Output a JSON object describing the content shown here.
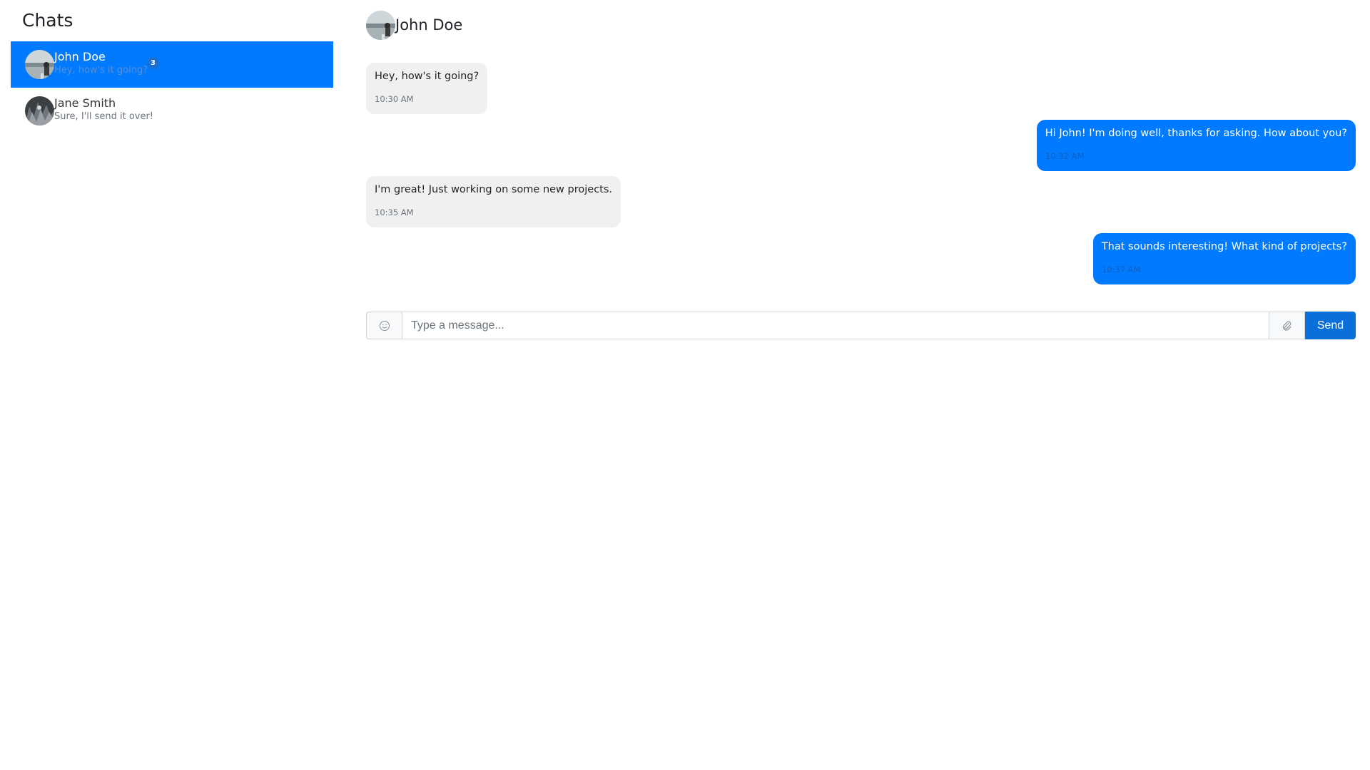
{
  "sidebar": {
    "title": "Chats",
    "chats": [
      {
        "name": "John Doe",
        "preview": "Hey, how's it going?",
        "unread": "3",
        "active": true
      },
      {
        "name": "Jane Smith",
        "preview": "Sure, I'll send it over!",
        "active": false
      }
    ]
  },
  "conversation": {
    "header_name": "John Doe",
    "messages": [
      {
        "direction": "received",
        "text": "Hey, how's it going?",
        "time": "10:30 AM"
      },
      {
        "direction": "sent",
        "text": "Hi John! I'm doing well, thanks for asking. How about you?",
        "time": "10:32 AM"
      },
      {
        "direction": "received",
        "text": "I'm great! Just working on some new projects.",
        "time": "10:35 AM"
      },
      {
        "direction": "sent",
        "text": "That sounds interesting! What kind of projects?",
        "time": "10:37 AM"
      }
    ]
  },
  "composer": {
    "placeholder": "Type a message...",
    "value": "",
    "send_label": "Send",
    "emoji_icon": "smiley-icon",
    "attach_icon": "paperclip-icon"
  },
  "colors": {
    "accent": "#007bff",
    "received_bubble": "#f0f0f0",
    "send_button": "#0a6fd8"
  }
}
